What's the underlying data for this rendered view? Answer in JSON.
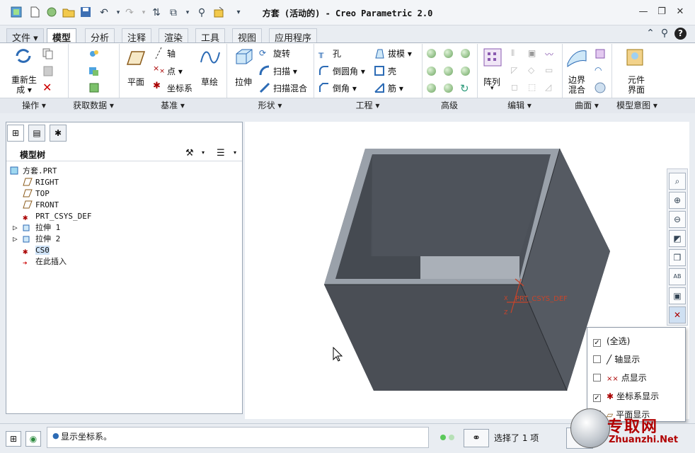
{
  "window": {
    "title": "方套 (活动的) - Creo Parametric 2.0",
    "min": "—",
    "restore": "❐",
    "close": "✕"
  },
  "quick_access": {
    "sep": "▾"
  },
  "tabs": [
    "文件 ▾",
    "模型",
    "分析",
    "注释",
    "渲染",
    "工具",
    "视图",
    "应用程序"
  ],
  "help": {
    "collapse": "⌃",
    "search": "⚲",
    "help": "?"
  },
  "ribbon": {
    "regen": "重新生\n成 ▾",
    "plane": "平面",
    "axis": "轴",
    "point": "点 ▾",
    "csys": "坐标系",
    "sketch": "草绘",
    "extrude": "拉伸",
    "revolve": "旋转",
    "sweep": "扫描 ▾",
    "swept_blend": "扫描混合",
    "hole": "孔",
    "round": "倒圆角 ▾",
    "chamfer": "倒角 ▾",
    "draft": "拔模 ▾",
    "shell": "壳",
    "rib": "筋 ▾",
    "pattern": "阵列",
    "pattern_arrow": "▾",
    "boundary_blend": "边界\n混合",
    "component_interface": "元件\n界面"
  },
  "groups": [
    "操作 ▾",
    "获取数据 ▾",
    "基准 ▾",
    "形状 ▾",
    "工程 ▾",
    "高级",
    "编辑 ▾",
    "曲面 ▾",
    "模型意图 ▾"
  ],
  "model_tree": {
    "title": "模型树",
    "items": [
      "方套.PRT",
      "RIGHT",
      "TOP",
      "FRONT",
      "PRT_CSYS_DEF",
      "拉伸 1",
      "拉伸 2",
      "CS0",
      "在此插入"
    ],
    "expanders": [
      "▷",
      "▷"
    ]
  },
  "viewport": {
    "csys_label": "PRT_CSYS_DEF",
    "axis_x": "X",
    "axis_z": "Z"
  },
  "dropdown": {
    "items": [
      {
        "label": "(全选)",
        "checked": true
      },
      {
        "label": "轴显示",
        "checked": false
      },
      {
        "label": "点显示",
        "checked": false
      },
      {
        "label": "坐标系显示",
        "checked": true
      },
      {
        "label": "平面显示",
        "checked": false
      }
    ]
  },
  "status": {
    "message": "显示坐标系。",
    "selection": "选择了 1 项"
  },
  "watermark": {
    "main": "专取网",
    "sub": "Zhuanzhi.Net"
  }
}
